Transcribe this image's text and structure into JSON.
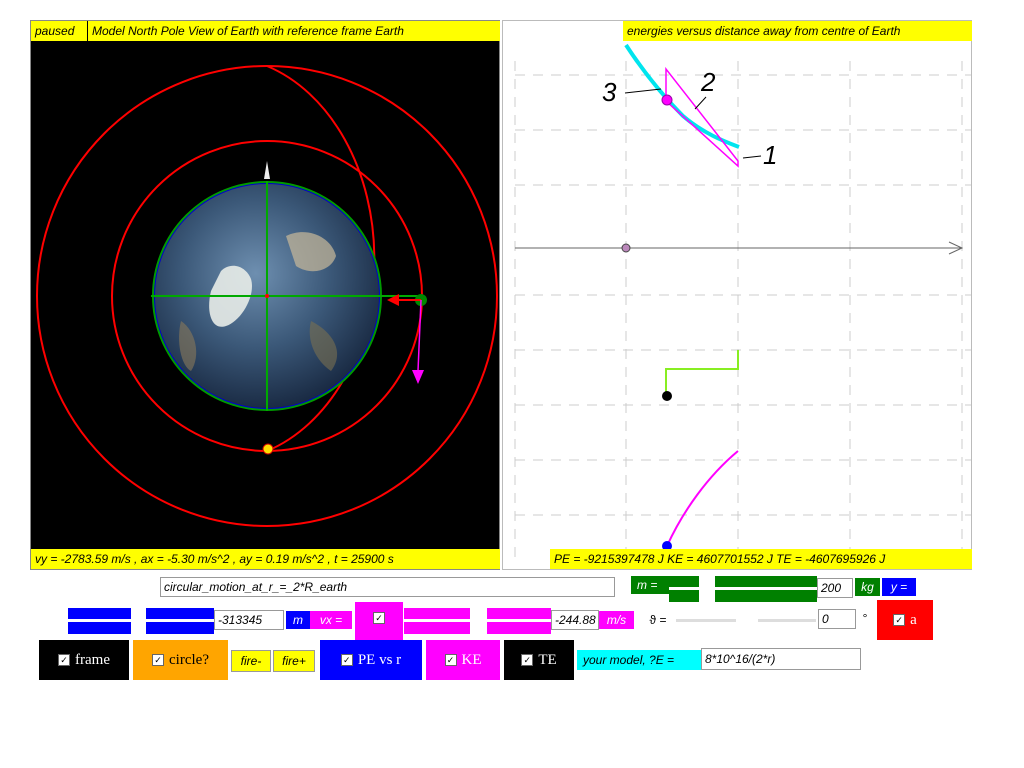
{
  "left_panel": {
    "status": "paused",
    "title": "Model North Pole View of Earth with reference frame Earth",
    "readout": "vy = -2783.59 m/s , ax = -5.30 m/s^2 , ay = 0.19 m/s^2 , t = 25900 s"
  },
  "right_panel": {
    "title": "energies versus distance away from centre of Earth",
    "readout": "PE = -9215397478 J KE = 4607701552 J TE = -4607695926 J",
    "annotations": [
      "1",
      "2",
      "3"
    ]
  },
  "controls": {
    "model_name": "circular_motion_at_r_=_2*R_earth",
    "mass_label": "m =",
    "mass_value": "200",
    "mass_unit": "kg",
    "y_label": "y =",
    "x_value": "-313345",
    "x_unit": "m",
    "vx_label": "vx =",
    "vx_value": "-244.88",
    "vx_unit": "m/s",
    "theta_label": "ϑ =",
    "theta_value": "0",
    "theta_unit": "°",
    "a_label": "a",
    "frame_label": "frame",
    "circle_label": "circle?",
    "fire_minus": "fire-",
    "fire_plus": "fire+",
    "pe_label": "PE vs r",
    "ke_label": "KE",
    "te_label": "TE",
    "your_model_label": "your model, ?E =",
    "your_model_value": "8*10^16/(2*r)"
  },
  "colors": {
    "yellow": "#ffff00",
    "green": "#008000",
    "blue": "#0000ff",
    "magenta": "#ff00ff",
    "red": "#ff0000",
    "orange": "#ffa500",
    "cyan": "#00ffff",
    "black": "#000000"
  }
}
